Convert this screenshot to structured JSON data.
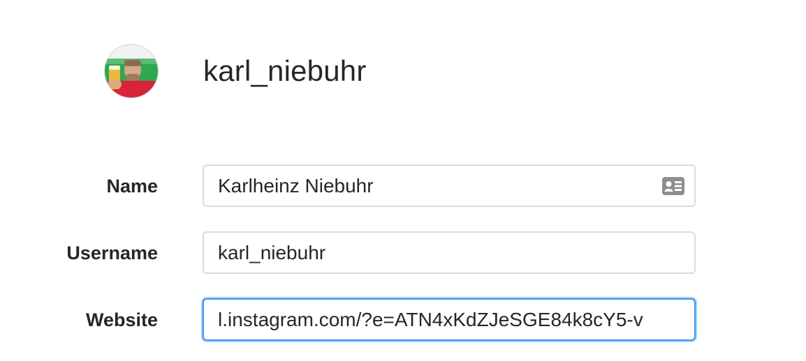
{
  "profile": {
    "username": "karl_niebuhr",
    "avatar_icon": "profile-photo"
  },
  "form": {
    "name": {
      "label": "Name",
      "value": "Karlheinz Niebuhr",
      "icon": "contact-card-icon"
    },
    "username": {
      "label": "Username",
      "value": "karl_niebuhr"
    },
    "website": {
      "label": "Website",
      "value": "l.instagram.com/?e=ATN4xKdZJeSGE84k8cY5-v",
      "focused": true
    }
  },
  "colors": {
    "text": "#262626",
    "border": "#dbdbdb",
    "focus": "#3897f0",
    "icon": "#8e8e8e"
  }
}
